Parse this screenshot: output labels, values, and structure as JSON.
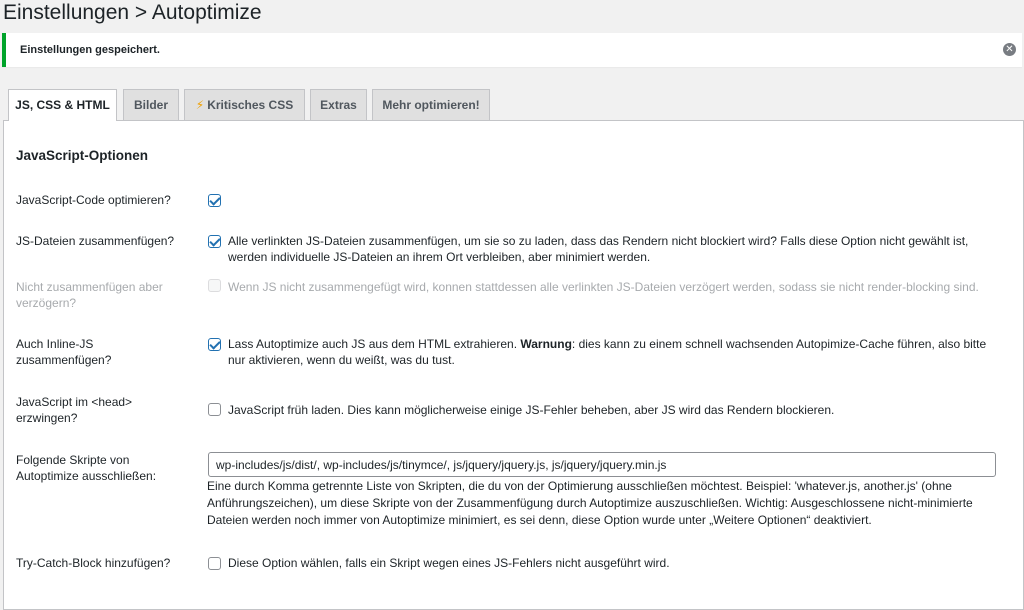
{
  "page_title": "Einstellungen > Autoptimize",
  "notice": {
    "text": "Einstellungen gespeichert.",
    "dismiss_icon": "close-icon"
  },
  "tabs": [
    {
      "label": "JS, CSS & HTML",
      "active": true
    },
    {
      "label": "Bilder",
      "active": false
    },
    {
      "label": "Kritisches CSS",
      "active": false,
      "icon": "lightning-icon"
    },
    {
      "label": "Extras",
      "active": false
    },
    {
      "label": "Mehr optimieren!",
      "active": false
    }
  ],
  "section_title": "JavaScript-Optionen",
  "options": {
    "optimize": {
      "label": "JavaScript-Code optimieren?",
      "checked": true
    },
    "aggregate": {
      "label": "JS-Dateien zusammenfügen?",
      "checked": true,
      "desc": "Alle verlinkten JS-Dateien zusammenfügen, um sie so zu laden, dass das Rendern nicht blockiert wird? Falls diese Option nicht gewählt ist, werden individuelle JS-Dateien an ihrem Ort verbleiben, aber minimiert werden."
    },
    "defer": {
      "label": "Nicht zusammenfügen aber verzögern?",
      "checked": false,
      "disabled": true,
      "desc": "Wenn JS nicht zusammengefügt wird, konnen stattdessen alle verlinkten JS-Dateien verzögert werden, sodass sie nicht render-blocking sind."
    },
    "inline": {
      "label": "Auch Inline-JS zusammenfügen?",
      "checked": true,
      "desc_pre": "Lass Autoptimize auch JS aus dem HTML extrahieren. ",
      "desc_bold": "Warnung",
      "desc_post": ": dies kann zu einem schnell wachsenden Autopimize-Cache führen, also bitte nur aktivieren, wenn du weißt, was du tust."
    },
    "head": {
      "label": "JavaScript im <head> erzwingen?",
      "checked": false,
      "desc": "JavaScript früh laden. Dies kann möglicherweise einige JS-Fehler beheben, aber JS wird das Rendern blockieren."
    },
    "exclude": {
      "label": "Folgende Skripte von Autoptimize ausschließen:",
      "value": "wp-includes/js/dist/, wp-includes/js/tinymce/, js/jquery/jquery.js, js/jquery/jquery.min.js",
      "help": "Eine durch Komma getrennte Liste von Skripten, die du von der Optimierung ausschließen möchtest. Beispiel: 'whatever.js, another.js' (ohne Anführungszeichen), um diese Skripte von der Zusammenfügung durch Autoptimize auszuschließen. Wichtig: Ausgeschlossene nicht-minimierte Dateien werden noch immer von Autoptimize minimiert, es sei denn, diese Option wurde unter „Weitere Optionen“ deaktiviert."
    },
    "trycatch": {
      "label": "Try-Catch-Block hinzufügen?",
      "checked": false,
      "desc": "Diese Option wählen, falls ein Skript wegen eines JS-Fehlers nicht ausgeführt wird."
    }
  },
  "colors": {
    "accent": "#2271b1",
    "success": "#00a32a",
    "bolt": "#f0a000"
  }
}
